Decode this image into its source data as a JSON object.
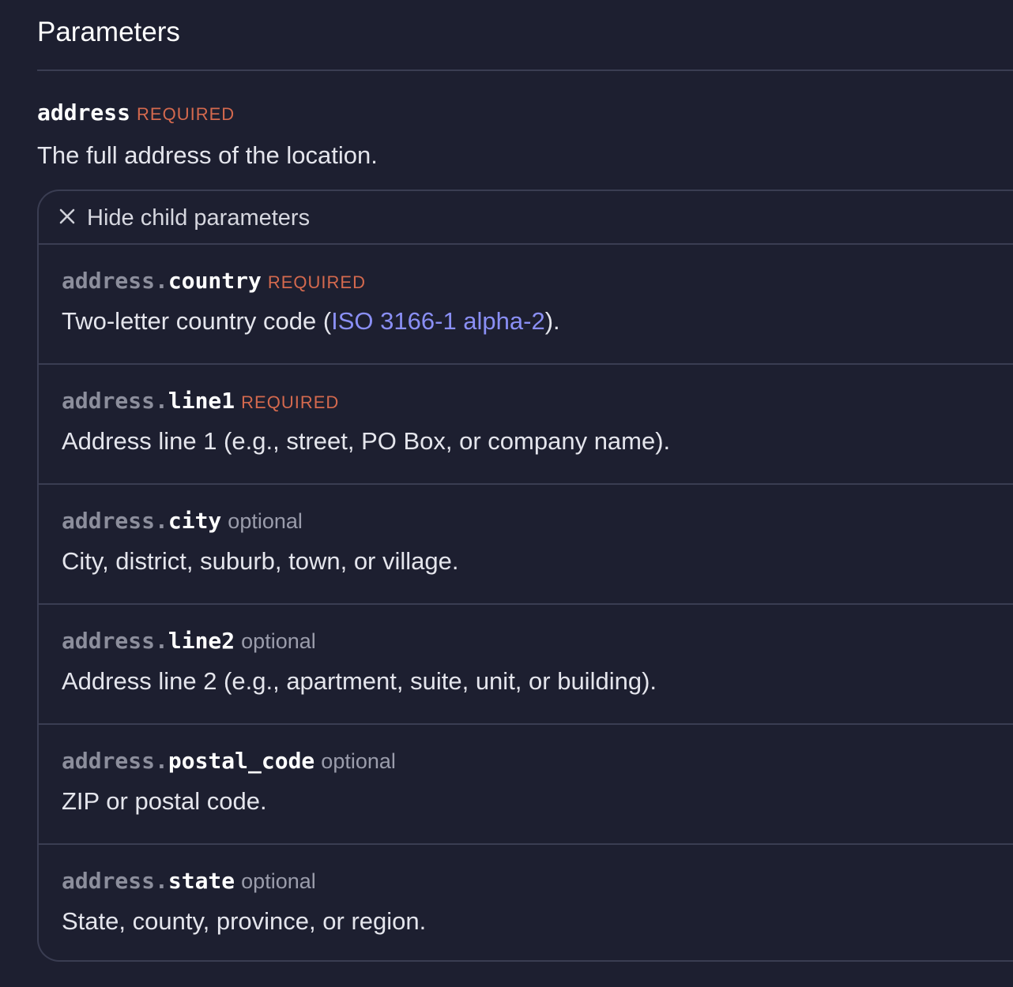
{
  "section": {
    "heading": "Parameters"
  },
  "param": {
    "name": "address",
    "badge": "REQUIRED",
    "description": "The full address of the location."
  },
  "children_toggle": {
    "icon": "close-icon",
    "label": "Hide child parameters"
  },
  "children": [
    {
      "prefix": "address.",
      "name": "country",
      "badge": "REQUIRED",
      "description_before": "Two-letter country code (",
      "description_link": "ISO 3166-1 alpha-2",
      "description_after": ")."
    },
    {
      "prefix": "address.",
      "name": "line1",
      "badge": "REQUIRED",
      "description": "Address line 1 (e.g., street, PO Box, or company name)."
    },
    {
      "prefix": "address.",
      "name": "city",
      "badge": "optional",
      "description": "City, district, suburb, town, or village."
    },
    {
      "prefix": "address.",
      "name": "line2",
      "badge": "optional",
      "description": "Address line 2 (e.g., apartment, suite, unit, or building)."
    },
    {
      "prefix": "address.",
      "name": "postal_code",
      "badge": "optional",
      "description": "ZIP or postal code."
    },
    {
      "prefix": "address.",
      "name": "state",
      "badge": "optional",
      "description": "State, county, province, or region."
    }
  ],
  "colors": {
    "background": "#1d1f30",
    "required_badge": "#d4694e",
    "optional_badge": "#9a9cab",
    "link": "#8a8ff5",
    "divider": "#3a3d52"
  }
}
